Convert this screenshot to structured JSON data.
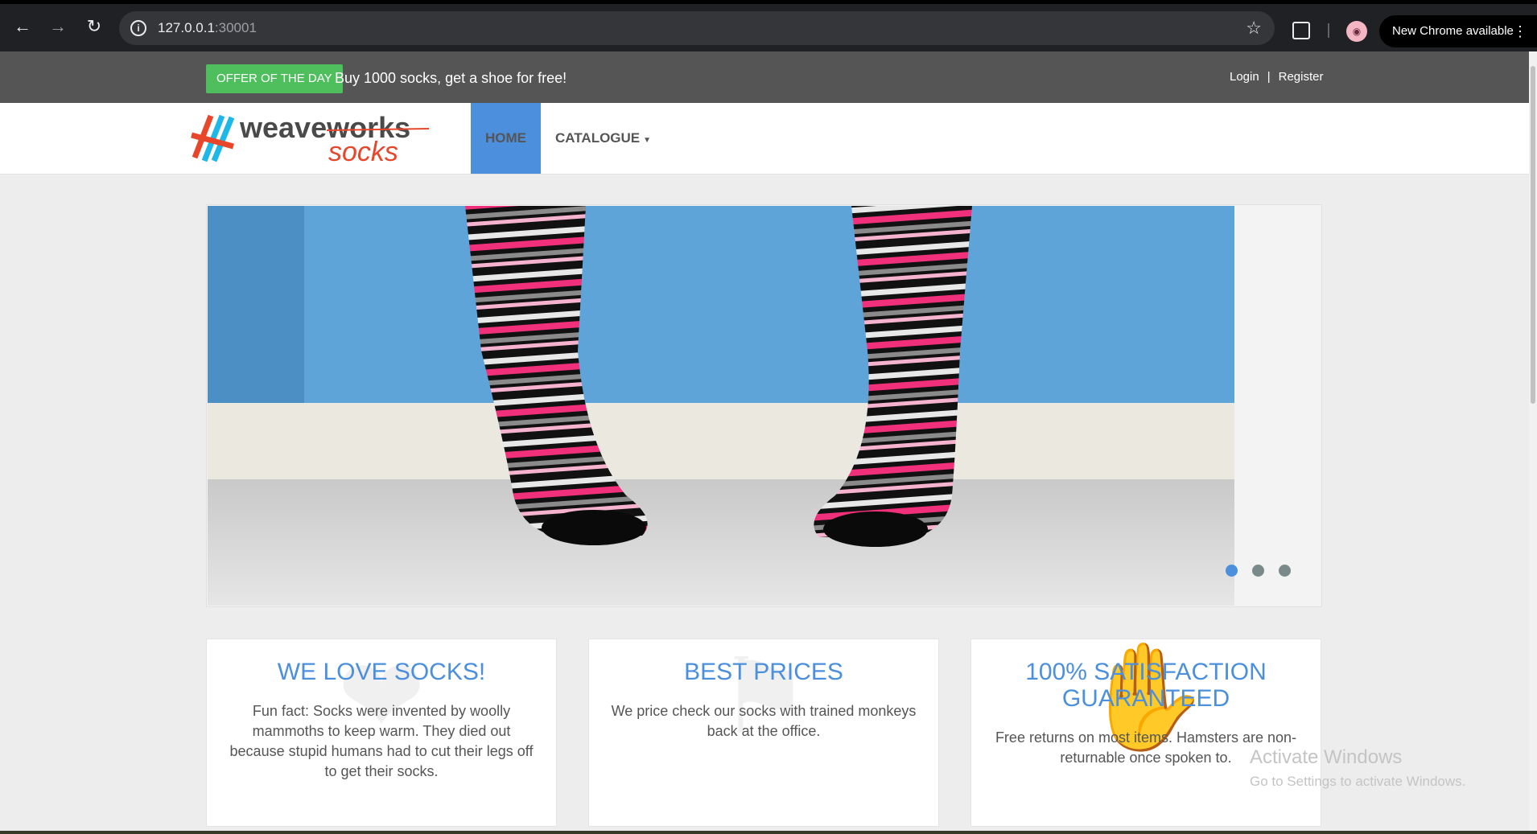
{
  "browser": {
    "url_host": "127.0.0.1",
    "url_port": ":30001",
    "update_label": "New Chrome available"
  },
  "top_bar": {
    "offer_badge": "OFFER OF THE DAY",
    "offer_text": "Buy 1000 socks, get a shoe for free!",
    "login": "Login",
    "separator": "|",
    "register": "Register"
  },
  "logo": {
    "line1": "weaveworks",
    "line2": "socks"
  },
  "nav": {
    "home": "HOME",
    "catalogue": "CATALOGUE"
  },
  "carousel": {
    "slide_count": 3,
    "active_index": 0
  },
  "features": [
    {
      "title": "WE LOVE SOCKS!",
      "text": "Fun fact: Socks were invented by woolly mammoths to keep warm. They died out because stupid humans had to cut their legs off to get their socks.",
      "icon": "heart-icon"
    },
    {
      "title": "BEST PRICES",
      "text": "We price check our socks with trained monkeys back at the office.",
      "icon": "tags-icon"
    },
    {
      "title": "100% SATISFACTION GUARANTEED",
      "text": "Free returns on most items. Hamsters are non-returnable once spoken to.",
      "icon": "thumbs-up-icon"
    }
  ],
  "watermark": {
    "title": "Activate Windows",
    "subtitle": "Go to Settings to activate Windows."
  },
  "colors": {
    "accent": "#4b8fdd",
    "offer_green": "#4fbf5e",
    "top_bar": "#555555"
  }
}
